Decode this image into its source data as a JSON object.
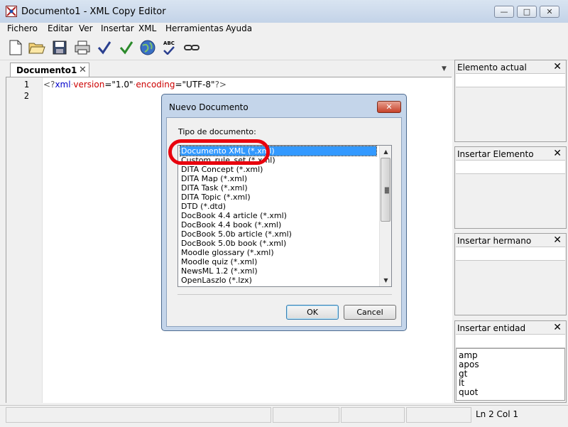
{
  "window": {
    "title": "Documento1 - XML Copy Editor",
    "minimize": "—",
    "maximize": "□",
    "close": "✕"
  },
  "menu": [
    "Fichero",
    "Editar",
    "Ver",
    "Insertar",
    "XML",
    "Herramientas",
    "Ayuda"
  ],
  "toolbar": {
    "icons": [
      "new-document-icon",
      "open-folder-icon",
      "save-icon",
      "print-icon",
      "check-wellformed-icon",
      "validate-icon",
      "browser-icon",
      "spellcheck-icon",
      "link-icon"
    ],
    "spell_label": "ABC"
  },
  "editor": {
    "tab_label": "Documento1",
    "tab_close": "✕",
    "line_numbers": [
      "1",
      "2"
    ],
    "code": {
      "open": "<?",
      "tag": "xml",
      "attr1": "version",
      "eq": "=",
      "val1": "\"1.0\"",
      "attr2": "encoding",
      "val2": "\"UTF-8\"",
      "close": "?>"
    }
  },
  "panels": {
    "current_element": "Elemento actual",
    "insert_element": "Insertar Elemento",
    "insert_sibling": "Insertar hermano",
    "insert_entity": "Insertar entidad",
    "close": "✕",
    "entities": [
      "amp",
      "apos",
      "gt",
      "lt",
      "quot"
    ]
  },
  "dialog": {
    "title": "Nuevo Documento",
    "close": "✕",
    "label": "Tipo de documento:",
    "options": [
      "Documento XML (*.xml)",
      "Custom_rule_set (*.xml)",
      "DITA Concept (*.xml)",
      "DITA Map (*.xml)",
      "DITA Task (*.xml)",
      "DITA Topic (*.xml)",
      "DTD (*.dtd)",
      "DocBook 4.4 article (*.xml)",
      "DocBook 4.4 book (*.xml)",
      "DocBook 5.0b article (*.xml)",
      "DocBook 5.0b book (*.xml)",
      "Moodle glossary (*.xml)",
      "Moodle quiz (*.xml)",
      "NewsML 1.2 (*.xml)",
      "OpenLaszlo (*.lzx)"
    ],
    "selected_index": 0,
    "ok_label": "OK",
    "cancel_label": "Cancel"
  },
  "status": {
    "position": "Ln 2 Col 1"
  },
  "colors": {
    "highlight": "#e8000d",
    "selection": "#3399ff",
    "xml_tag": "#0000cc",
    "xml_attr": "#cc0000"
  }
}
